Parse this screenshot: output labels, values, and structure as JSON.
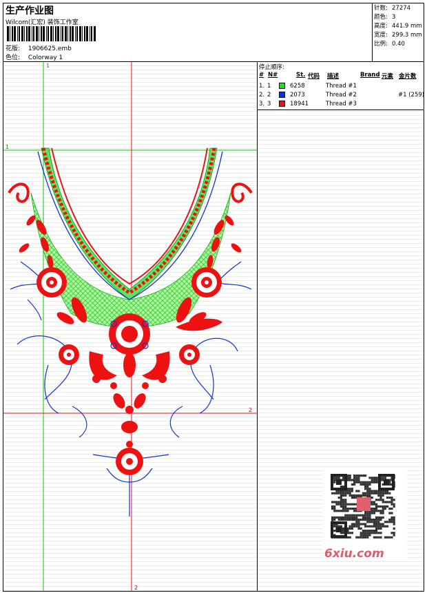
{
  "header": {
    "title": "生产作业图",
    "company": "Wilcom(汇宏) 装饰工作室",
    "design_label": "花版:",
    "design_value": "1906625.emb",
    "colorway_label": "色位:",
    "colorway_value": "Colorway 1"
  },
  "stats": [
    {
      "label": "针数:",
      "value": "27274"
    },
    {
      "label": "颜色:",
      "value": "3"
    },
    {
      "label": "高度:",
      "value": "441.9 mm"
    },
    {
      "label": "宽度:",
      "value": "299.3 mm"
    },
    {
      "label": "比例:",
      "value": "0.40"
    }
  ],
  "stop_sequence": {
    "title": "停止顺序:",
    "columns": [
      "#",
      "N#",
      "St.",
      "代码",
      "描述",
      "Brand",
      "元素",
      "金片数"
    ],
    "rows": [
      {
        "num": "1.",
        "n": "1",
        "color": "#22dd22",
        "stitches": "6258",
        "desc": "Thread #1",
        "extra": ""
      },
      {
        "num": "2.",
        "n": "2",
        "color": "#1030e0",
        "stitches": "2073",
        "desc": "Thread #2",
        "extra": "#1 (259)"
      },
      {
        "num": "3.",
        "n": "3",
        "color": "#ee1111",
        "stitches": "18941",
        "desc": "Thread #3",
        "extra": ""
      }
    ]
  },
  "guides": {
    "v1_label": "1",
    "h1_label": "1",
    "v2_label": "2",
    "h2_label": "2"
  },
  "watermark": {
    "text": "6xiu.com"
  },
  "colors": {
    "thread_green": "#22dd22",
    "thread_blue": "#1030e0",
    "thread_red": "#ee1111"
  }
}
